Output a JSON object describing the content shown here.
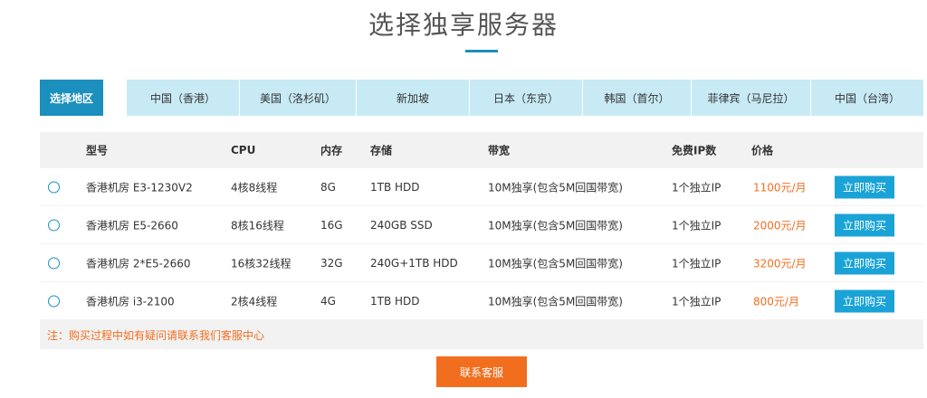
{
  "page": {
    "title": "选择独享服务器"
  },
  "regions": {
    "label": "选择地区",
    "tabs": [
      {
        "label": "中国（香港）"
      },
      {
        "label": "美国（洛杉矶）"
      },
      {
        "label": "新加坡"
      },
      {
        "label": "日本（东京）"
      },
      {
        "label": "韩国（首尔）"
      },
      {
        "label": "菲律宾（马尼拉）"
      },
      {
        "label": "中国（台湾）"
      }
    ]
  },
  "table": {
    "headers": {
      "model": "型号",
      "cpu": "CPU",
      "memory": "内存",
      "storage": "存储",
      "bandwidth": "带宽",
      "free_ip": "免费IP数",
      "price": "价格"
    },
    "rows": [
      {
        "model": "香港机房 E3-1230V2",
        "cpu": "4核8线程",
        "memory": "8G",
        "storage": "1TB HDD",
        "bandwidth": "10M独享(包含5M回国带宽)",
        "free_ip": "1个独立IP",
        "price": "1100元/月",
        "buy": "立即购买"
      },
      {
        "model": "香港机房 E5-2660",
        "cpu": "8核16线程",
        "memory": "16G",
        "storage": "240GB SSD",
        "bandwidth": "10M独享(包含5M回国带宽)",
        "free_ip": "1个独立IP",
        "price": "2000元/月",
        "buy": "立即购买"
      },
      {
        "model": "香港机房 2*E5-2660",
        "cpu": "16核32线程",
        "memory": "32G",
        "storage": "240G+1TB HDD",
        "bandwidth": "10M独享(包含5M回国带宽)",
        "free_ip": "1个独立IP",
        "price": "3200元/月",
        "buy": "立即购买"
      },
      {
        "model": "香港机房 i3-2100",
        "cpu": "2核4线程",
        "memory": "4G",
        "storage": "1TB HDD",
        "bandwidth": "10M独享(包含5M回国带宽)",
        "free_ip": "1个独立IP",
        "price": "800元/月",
        "buy": "立即购买"
      }
    ],
    "note": "注：购买过程中如有疑问请联系我们客服中心"
  },
  "contact": {
    "label": "联系客服"
  },
  "colors": {
    "accent": "#1b8fbd",
    "tab_bg": "#c8eaf5",
    "price": "#f26e1f",
    "buy_button": "#1aa3d6",
    "contact_button": "#f26e1f"
  }
}
